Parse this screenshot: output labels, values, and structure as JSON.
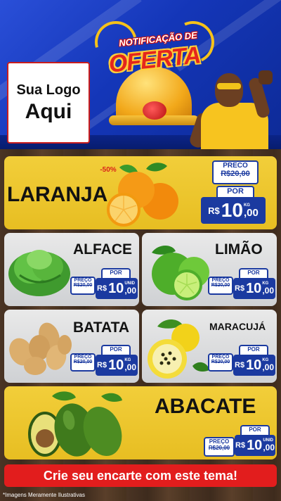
{
  "header": {
    "logo_line1": "Sua Logo",
    "logo_line2": "Aqui",
    "notif_text": "NOTIFICAÇÃO DE",
    "oferta_text": "OFERTA"
  },
  "featured": {
    "name": "LARANJA",
    "discount": "-50%",
    "preco_label": "PRECO",
    "old_price": "R$20,00",
    "por_label": "POR",
    "currency": "R$",
    "price_int": "10",
    "price_dec": ",00",
    "unit": "KG"
  },
  "products": [
    {
      "name": "ALFACE",
      "preco_label": "PREÇO",
      "old_price": "R$20,00",
      "por_label": "POR",
      "currency": "R$",
      "price_int": "10",
      "price_dec": ",00",
      "unit": "UNID"
    },
    {
      "name": "LIMÃO",
      "preco_label": "PREÇO",
      "old_price": "R$20,00",
      "por_label": "POR",
      "currency": "R$",
      "price_int": "10",
      "price_dec": ",00",
      "unit": "KG"
    },
    {
      "name": "BATATA",
      "preco_label": "PREÇO",
      "old_price": "R$20,00",
      "por_label": "POR",
      "currency": "R$",
      "price_int": "10",
      "price_dec": ",00",
      "unit": "KG"
    },
    {
      "name": "MARACUJÁ",
      "preco_label": "PREÇO",
      "old_price": "R$20,00",
      "por_label": "POR",
      "currency": "R$",
      "price_int": "10",
      "price_dec": ",00",
      "unit": "KG"
    }
  ],
  "bottom": {
    "name": "ABACATE",
    "preco_label": "PREÇO",
    "old_price": "R$20,00",
    "por_label": "POR",
    "currency": "R$",
    "price_int": "10",
    "price_dec": ",00",
    "unit": "UNID"
  },
  "cta": "Crie seu encarte com este tema!",
  "disclaimer": "*Imagens Meramente Ilustrativas",
  "colors": {
    "blue": "#1b3aa0",
    "yellow": "#f2ce3a",
    "red": "#e21d1d",
    "header": "#1436b8"
  },
  "icons": [
    "bell-icon",
    "orange-icon",
    "lettuce-icon",
    "lime-icon",
    "potato-icon",
    "passion-fruit-icon",
    "avocado-icon"
  ]
}
